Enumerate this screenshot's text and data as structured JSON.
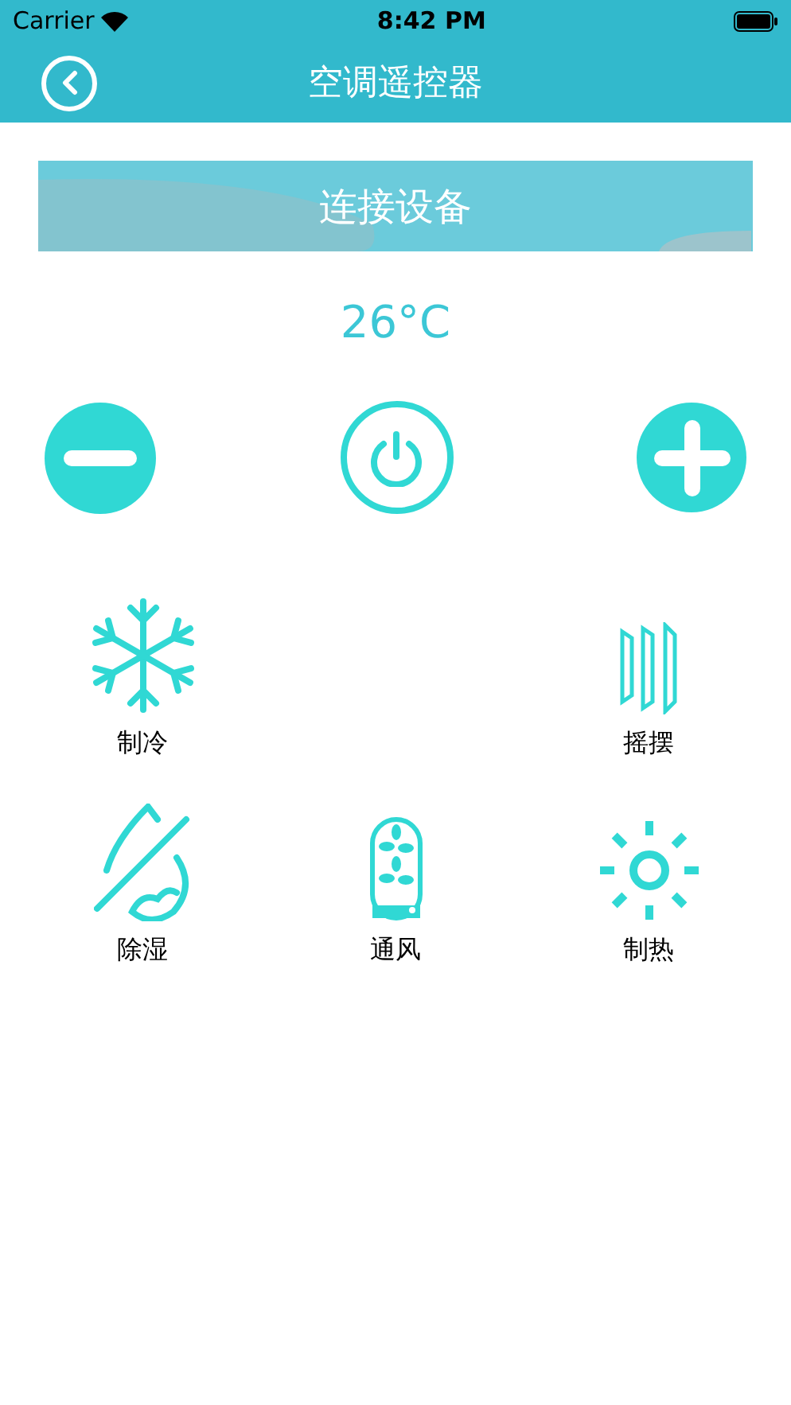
{
  "status_bar": {
    "carrier": "Carrier",
    "time": "8:42 PM"
  },
  "header": {
    "title": "空调遥控器"
  },
  "connect_button": {
    "label": "连接设备"
  },
  "temperature": "26°C",
  "mode_rows": [
    {
      "left": {
        "kind": "cool",
        "label": "制冷"
      },
      "right": {
        "kind": "swing",
        "label": "摇摆"
      }
    },
    {
      "left": {
        "kind": "dehumidify",
        "label": "除湿"
      },
      "center": {
        "kind": "fan",
        "label": "通风"
      },
      "right": {
        "kind": "heat",
        "label": "制热"
      }
    }
  ]
}
